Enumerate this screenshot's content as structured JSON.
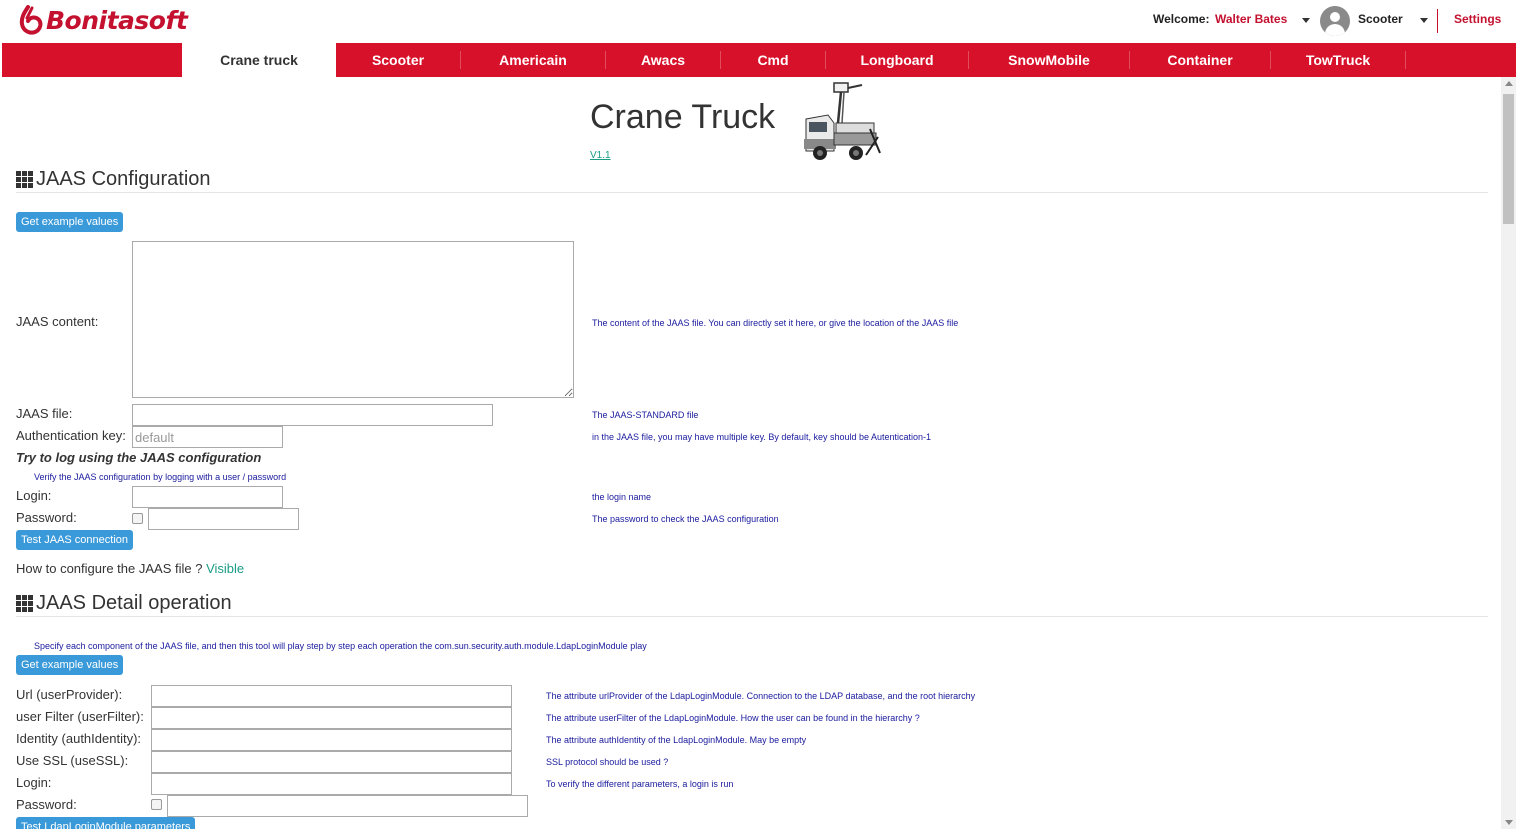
{
  "header": {
    "brand": "Bonitasoft",
    "welcome_label": "Welcome:",
    "user_name": "Walter Bates",
    "app_name": "Scooter",
    "settings_label": "Settings"
  },
  "nav": {
    "tabs": [
      {
        "label": "Crane truck",
        "active": true
      },
      {
        "label": "Scooter"
      },
      {
        "label": "Americain"
      },
      {
        "label": "Awacs"
      },
      {
        "label": "Cmd"
      },
      {
        "label": "Longboard"
      },
      {
        "label": "SnowMobile"
      },
      {
        "label": "Container"
      },
      {
        "label": "TowTruck"
      }
    ]
  },
  "page": {
    "title": "Crane Truck",
    "version": "V1.1"
  },
  "jaas_config": {
    "title": "JAAS Configuration",
    "example_button": "Get example values",
    "content_label": "JAAS content:",
    "content_help": "The content of the JAAS file. You can directly set it here, or give the location of the JAAS file",
    "file_label": "JAAS file:",
    "file_help": "The JAAS-STANDARD file",
    "auth_key_label": "Authentication key:",
    "auth_key_placeholder": "default",
    "auth_key_help": "in the JAAS file, you may have multiple key. By default, key should be Autentication-1",
    "try_title": "Try to log using the JAAS configuration",
    "try_help": "Verify the JAAS configuration by logging with a user / password",
    "login_label": "Login:",
    "login_help": "the login name",
    "password_label": "Password:",
    "password_help": "The password to check the JAAS configuration",
    "test_button": "Test JAAS connection",
    "howto_text": "How to configure the JAAS file ?",
    "howto_link": "Visible"
  },
  "jaas_detail": {
    "title": "JAAS Detail operation",
    "intro": "Specify each component of the JAAS file, and then this tool will play step by step each operation the com.sun.security.auth.module.LdapLoginModule play",
    "example_button": "Get example values",
    "url_label": "Url (userProvider):",
    "url_help": "The attribute urlProvider of the LdapLoginModule. Connection to the LDAP database, and the root hierarchy",
    "filter_label": "user Filter (userFilter):",
    "filter_help": "The attribute userFilter of the LdapLoginModule. How the user can be found in the hierarchy ?",
    "identity_label": "Identity (authIdentity):",
    "identity_help": "The attribute authIdentity of the LdapLoginModule. May be empty",
    "ssl_label": "Use SSL (useSSL):",
    "ssl_help": "SSL protocol should be used ?",
    "login_label": "Login:",
    "login_help": "To verify the different parameters, a login is run",
    "password_label": "Password:",
    "test_button": "Test LdapLoginModule parameters"
  },
  "colors": {
    "brand_red": "#d8112a",
    "button_blue": "#3a9ad9",
    "help_text": "#1a1a9e",
    "link_green": "#1a9c86"
  }
}
